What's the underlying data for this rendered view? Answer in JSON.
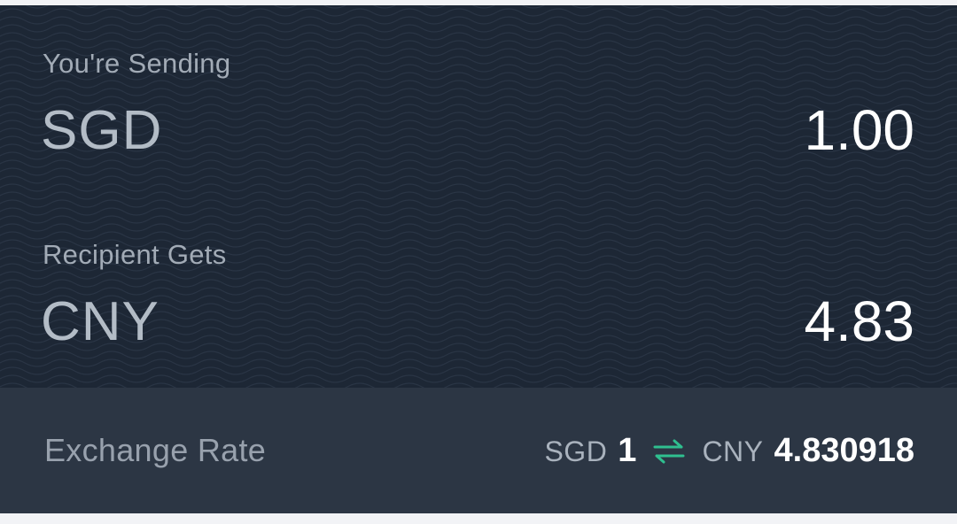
{
  "sending": {
    "label": "You're Sending",
    "currency": "SGD",
    "amount": "1.00"
  },
  "receiving": {
    "label": "Recipient Gets",
    "currency": "CNY",
    "amount": "4.83"
  },
  "exchange": {
    "label": "Exchange Rate",
    "from_currency": "SGD",
    "from_amount": "1",
    "to_currency": "CNY",
    "to_amount": "4.830918",
    "swap_icon": "swap-arrows-icon"
  },
  "colors": {
    "card_background": "#1d2735",
    "rate_bar_background": "#2c3644",
    "accent_green": "#2fbf8f"
  }
}
